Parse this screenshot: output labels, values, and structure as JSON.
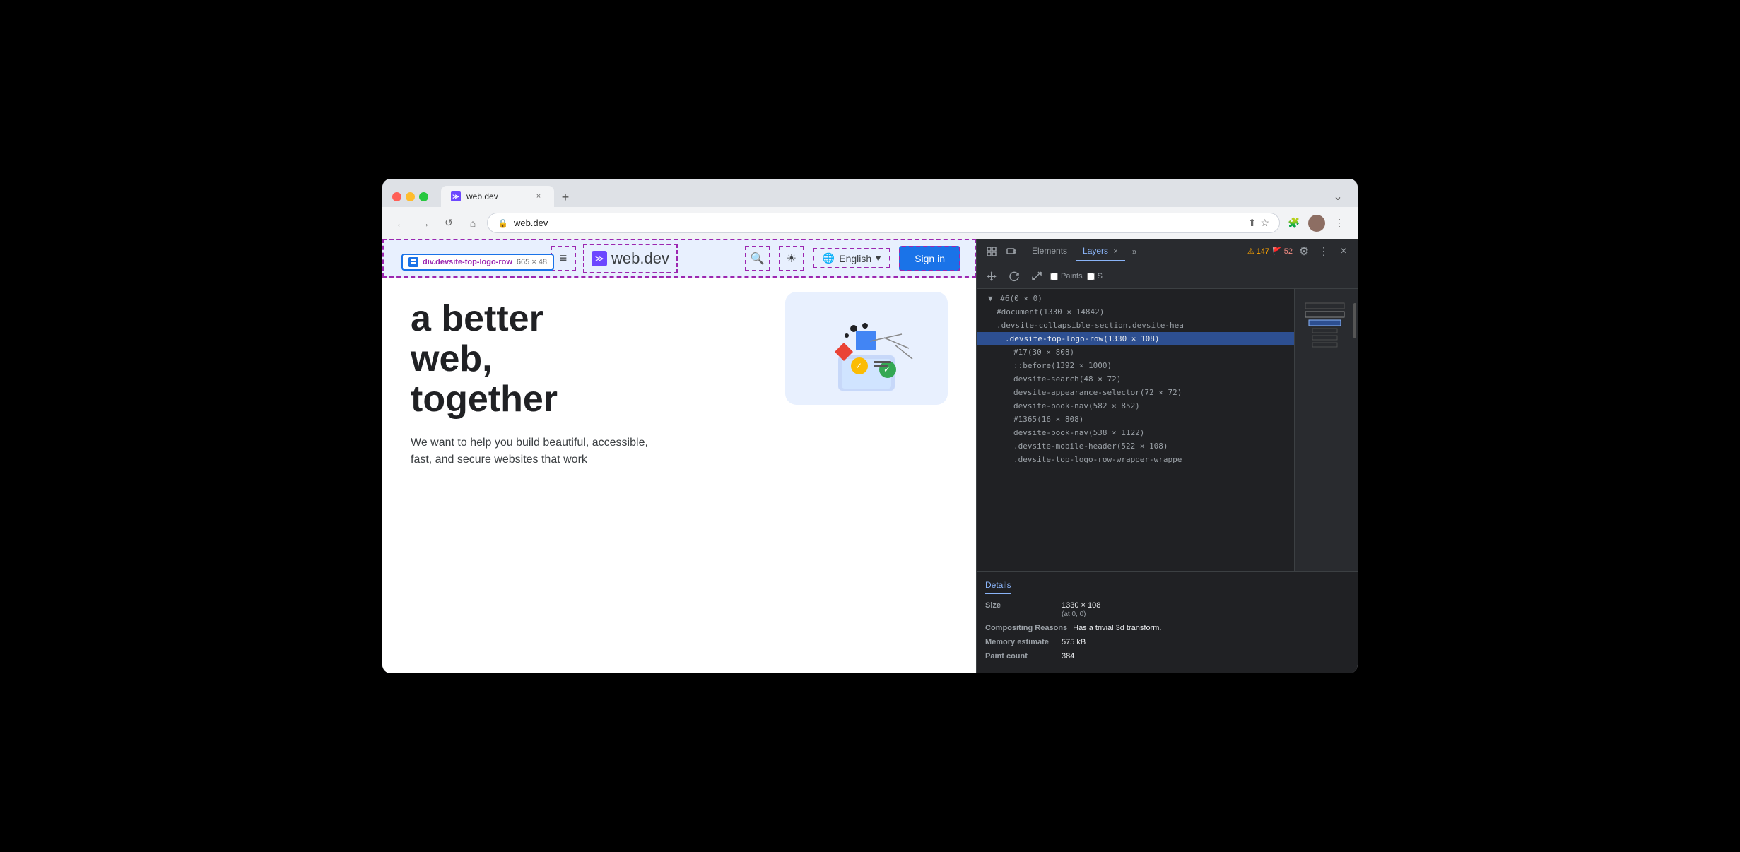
{
  "browser": {
    "tab_title": "web.dev",
    "tab_favicon": "≫",
    "address": "web.dev",
    "new_tab_btn": "+",
    "chevron_btn": "⌄"
  },
  "nav": {
    "back_btn": "←",
    "forward_btn": "→",
    "refresh_btn": "↺",
    "home_btn": "⌂",
    "address_icon": "🔒",
    "share_btn": "⬆",
    "bookmark_btn": "☆",
    "extensions_btn": "🧩",
    "more_btn": "⋮"
  },
  "webpage": {
    "header": {
      "hamburger": "≡",
      "logo_text": "web.dev",
      "search_icon": "🔍",
      "theme_icon": "☀",
      "globe_icon": "🌐",
      "language": "English",
      "language_arrow": "▾",
      "sign_in": "Sign in"
    },
    "inspector": {
      "element_name": "div.devsite-top-logo-row",
      "dimensions": "665 × 48"
    },
    "content": {
      "headline_line1": "a better",
      "headline_line2": "web,",
      "headline_line3": "together",
      "subtext": "We want to help you build beautiful, accessible, fast, and secure websites that work"
    }
  },
  "devtools": {
    "toolbar": {
      "inspect_icon": "⛶",
      "device_icon": "⬜",
      "tab_elements": "Elements",
      "tab_layers": "Layers",
      "tab_layers_close": "×",
      "tab_more": "»",
      "warning_icon": "⚠",
      "warning_count": "147",
      "error_icon": "🚩",
      "error_count": "52",
      "settings_icon": "⚙",
      "menu_icon": "⋮",
      "close_icon": "×"
    },
    "layers_toolbar": {
      "pan_icon": "✥",
      "rotate_icon": "↺",
      "resize_icon": "⤡",
      "paints_label": "Paints",
      "scroll_label": "S"
    },
    "tree": {
      "items": [
        {
          "indent": 0,
          "text": "▼#6(0 × 0)",
          "selected": false
        },
        {
          "indent": 1,
          "text": "#document(1330 × 14842)",
          "selected": false
        },
        {
          "indent": 1,
          "text": ".devsite-collapsible-section.devsite-hea",
          "selected": false
        },
        {
          "indent": 2,
          "text": ".devsite-top-logo-row(1330 × 108)",
          "selected": true
        },
        {
          "indent": 3,
          "text": "#17(30 × 808)",
          "selected": false
        },
        {
          "indent": 3,
          "text": "::before(1392 × 1000)",
          "selected": false
        },
        {
          "indent": 3,
          "text": "devsite-search(48 × 72)",
          "selected": false
        },
        {
          "indent": 3,
          "text": "devsite-appearance-selector(72 × 72)",
          "selected": false
        },
        {
          "indent": 3,
          "text": "devsite-book-nav(582 × 852)",
          "selected": false
        },
        {
          "indent": 3,
          "text": "#1365(16 × 808)",
          "selected": false
        },
        {
          "indent": 3,
          "text": "devsite-book-nav(538 × 1122)",
          "selected": false
        },
        {
          "indent": 3,
          "text": ".devsite-mobile-header(522 × 108)",
          "selected": false
        },
        {
          "indent": 3,
          "text": ".devsite-top-logo-row-wrapper-wrappe",
          "selected": false
        }
      ]
    },
    "details": {
      "tab_label": "Details",
      "size_label": "Size",
      "size_value": "1330 × 108",
      "size_sub": "(at 0, 0)",
      "compositing_label": "Compositing Reasons",
      "compositing_value": "Has a trivial 3d transform.",
      "memory_label": "Memory estimate",
      "memory_value": "575 kB",
      "paint_count_label": "Paint count",
      "paint_count_value": "384"
    }
  }
}
